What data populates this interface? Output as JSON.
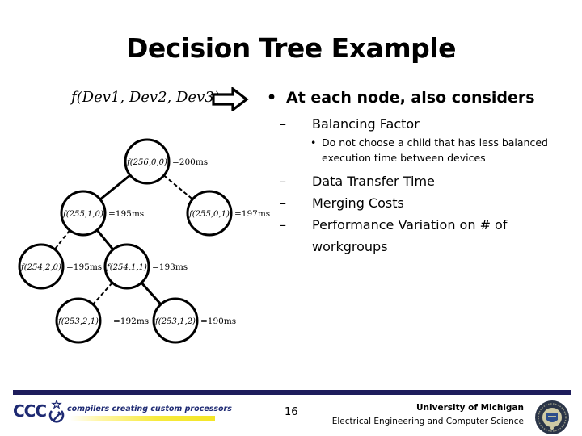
{
  "slide": {
    "title": "Decision Tree Example",
    "function_label": "f(Dev1, Dev2, Dev3)",
    "arrow_icon": "right-arrow-icon",
    "bullets": {
      "main": "At each node, also considers",
      "main_marker": "•",
      "sub_marker": "–",
      "subsub_marker": "•",
      "balancing_factor": "Balancing Factor",
      "balancing_detail": "Do not choose a child that has less balanced execution time between devices",
      "data_transfer": "Data Transfer Time",
      "merging_costs": "Merging Costs",
      "performance_variation": "Performance Variation on # of workgroups"
    }
  },
  "tree": {
    "nodes": [
      {
        "id": "n0",
        "label": "f(256,0,0)",
        "time": "=200ms"
      },
      {
        "id": "n1",
        "label": "f(255,1,0)",
        "time": "=195ms"
      },
      {
        "id": "n2",
        "label": "f(255,0,1)",
        "time": "=197ms"
      },
      {
        "id": "n3",
        "label": "f(254,2,0)",
        "time": "=195ms"
      },
      {
        "id": "n4",
        "label": "f(254,1,1)",
        "time": "=193ms"
      },
      {
        "id": "n5",
        "label": "f(253,2,1)",
        "time": "=192ms"
      },
      {
        "id": "n6",
        "label": "f(253,1,2)",
        "time": "=190ms"
      }
    ],
    "edges": [
      {
        "from": "n0",
        "to": "n1",
        "style": "solid"
      },
      {
        "from": "n0",
        "to": "n2",
        "style": "dashed"
      },
      {
        "from": "n1",
        "to": "n3",
        "style": "dashed"
      },
      {
        "from": "n1",
        "to": "n4",
        "style": "solid"
      },
      {
        "from": "n4",
        "to": "n5",
        "style": "dashed"
      },
      {
        "from": "n4",
        "to": "n6",
        "style": "solid"
      }
    ]
  },
  "footer": {
    "logo_text": "CCC",
    "tagline": "compilers creating custom processors",
    "page_number": "16",
    "university": "University of Michigan",
    "department": "Electrical Engineering and Computer Science",
    "bar_color": "#1e1d5c",
    "brand_color": "#1e2a73"
  }
}
